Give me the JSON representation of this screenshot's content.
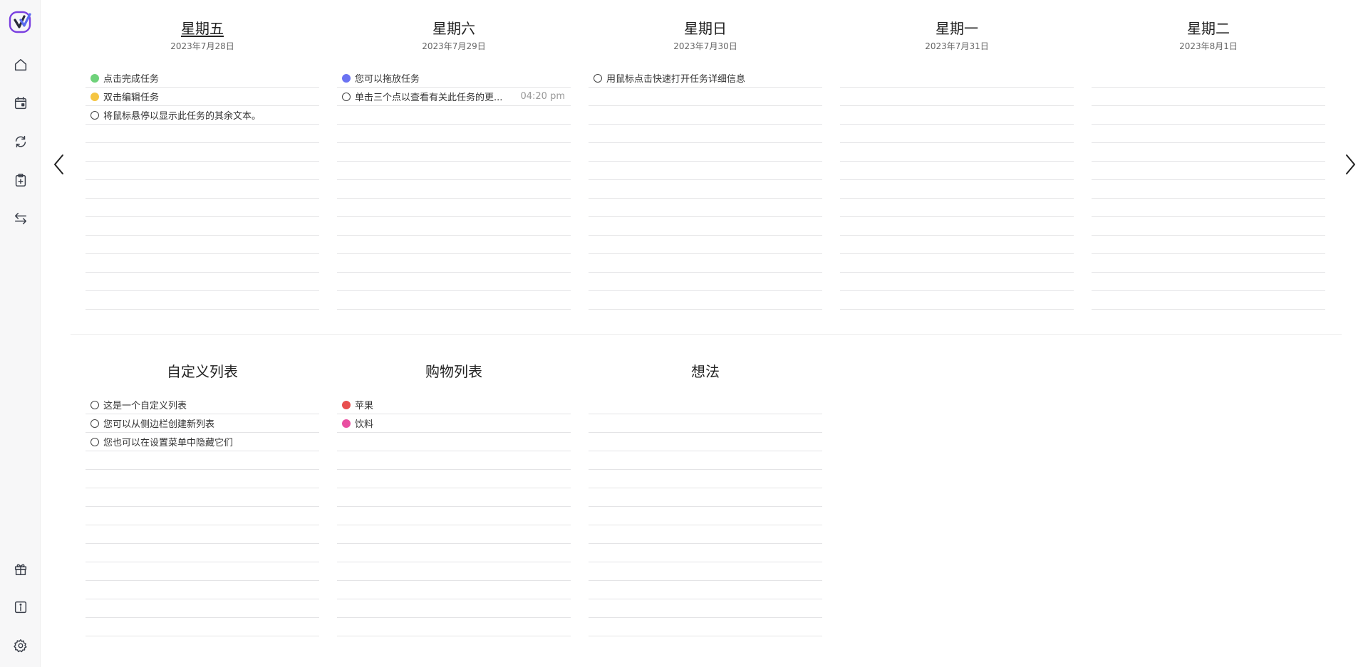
{
  "colors": {
    "green": "#6fd27a",
    "yellow": "#f5c542",
    "blue": "#6b73f2",
    "red": "#e84e4e",
    "pink": "#e94fa1",
    "brand": "#7a3fe0"
  },
  "sidebar": {
    "icons": [
      "home-icon",
      "calendar-icon",
      "sync-icon",
      "clipboard-icon",
      "transfer-icon",
      "gift-icon",
      "info-icon",
      "gear-icon"
    ]
  },
  "days": [
    {
      "title": "星期五",
      "date": "2023年7月28日",
      "tasks": [
        {
          "text": "点击完成任务",
          "marker": "dot",
          "color": "#6fd27a",
          "time": ""
        },
        {
          "text": "双击编辑任务",
          "marker": "dot",
          "color": "#f5c542",
          "time": ""
        },
        {
          "text": "将鼠标悬停以显示此任务的其余文本。",
          "marker": "circle",
          "color": "",
          "time": ""
        }
      ]
    },
    {
      "title": "星期六",
      "date": "2023年7月29日",
      "tasks": [
        {
          "text": "您可以拖放任务",
          "marker": "dot",
          "color": "#6b73f2",
          "time": ""
        },
        {
          "text": "单击三个点以查看有关此任务的更...",
          "marker": "circle",
          "color": "",
          "time": "04:20 pm"
        }
      ]
    },
    {
      "title": "星期日",
      "date": "2023年7月30日",
      "tasks": [
        {
          "text": "用鼠标点击快速打开任务详细信息",
          "marker": "circle",
          "color": "",
          "time": ""
        }
      ]
    },
    {
      "title": "星期一",
      "date": "2023年7月31日",
      "tasks": []
    },
    {
      "title": "星期二",
      "date": "2023年8月1日",
      "tasks": []
    }
  ],
  "lists": [
    {
      "title": "自定义列表",
      "tasks": [
        {
          "text": "这是一个自定义列表",
          "marker": "circle",
          "color": ""
        },
        {
          "text": "您可以从侧边栏创建新列表",
          "marker": "circle",
          "color": ""
        },
        {
          "text": "您也可以在设置菜单中隐藏它们",
          "marker": "circle",
          "color": ""
        }
      ]
    },
    {
      "title": "购物列表",
      "tasks": [
        {
          "text": "苹果",
          "marker": "dot",
          "color": "#e84e4e"
        },
        {
          "text": "饮料",
          "marker": "dot",
          "color": "#e94fa1"
        }
      ]
    },
    {
      "title": "想法",
      "tasks": []
    }
  ]
}
